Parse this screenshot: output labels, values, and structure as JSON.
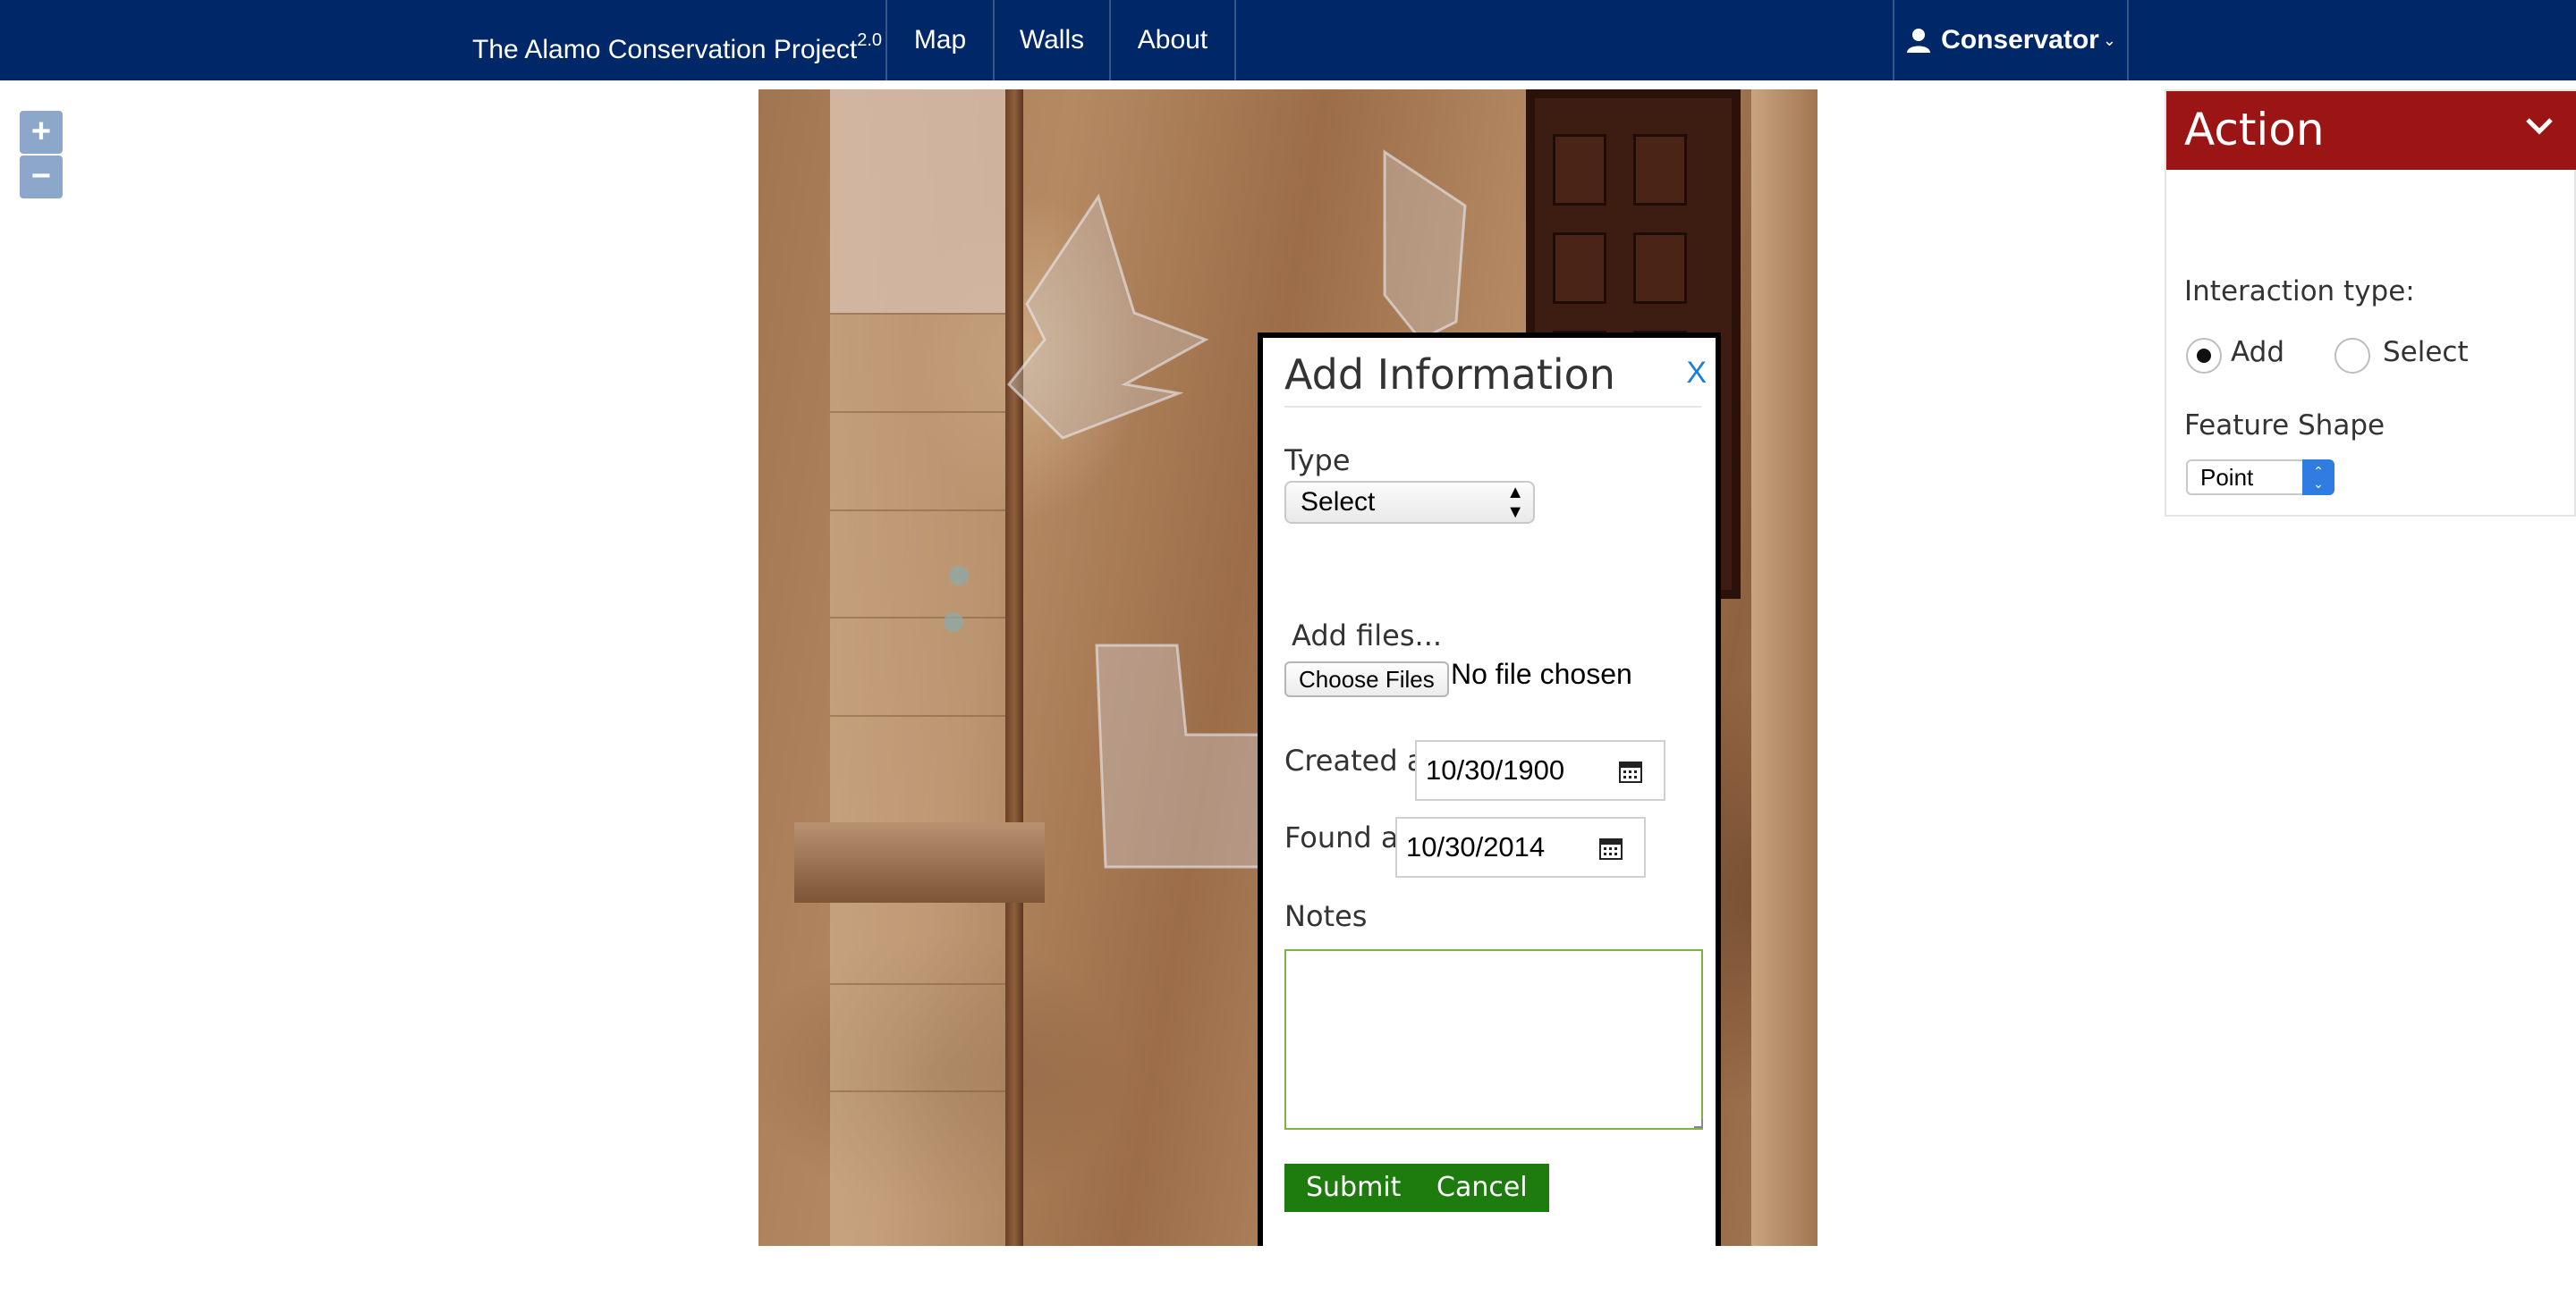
{
  "nav": {
    "brand": "The Alamo Conservation Project",
    "brand_version": "2.0",
    "items": [
      "Map",
      "Walls",
      "About"
    ],
    "user_label": "Conservator"
  },
  "zoom": {
    "in_label": "+",
    "out_label": "−"
  },
  "popup": {
    "title": "Add Information",
    "close_label": "X",
    "type_label": "Type",
    "type_value": "Select",
    "add_files_label": "Add files...",
    "choose_files_label": "Choose Files",
    "file_status": "No file chosen",
    "created_label": "Created at",
    "created_value": "10/30/1900",
    "found_label": "Found at",
    "found_value": "10/30/2014",
    "notes_label": "Notes",
    "notes_value": "",
    "submit_label": "Submit",
    "cancel_label": "Cancel"
  },
  "action": {
    "title": "Action",
    "interaction_label": "Interaction type:",
    "radio_add": "Add",
    "radio_select": "Select",
    "selected": "Add",
    "feature_shape_label": "Feature Shape",
    "feature_shape_value": "Point"
  },
  "colors": {
    "navbar": "#002868",
    "action_header": "#9b1515",
    "buttons": "#1e7c0f",
    "close_link": "#1a7fd8",
    "notes_border": "#7cb342"
  }
}
